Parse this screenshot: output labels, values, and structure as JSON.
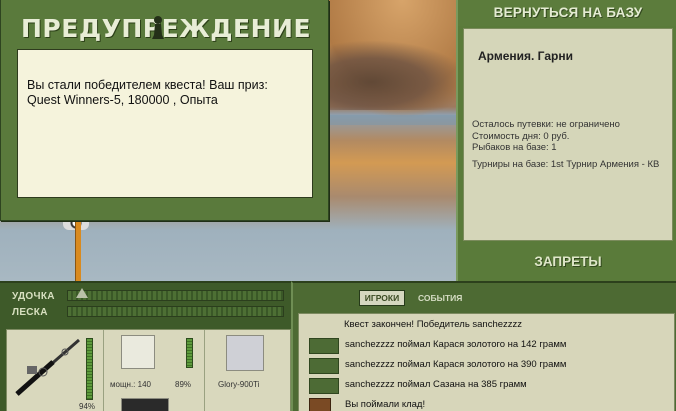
{
  "warning": {
    "title": "ПРЕДУПРЕЖДЕНИЕ",
    "message_line1": "Вы стали победителем квеста! Ваш приз:",
    "message_line2": "Quest Winners-5, 180000 , Опыта"
  },
  "base": {
    "return_label": "ВЕРНУТЬСЯ НА БАЗУ",
    "name": "Армения. Гарни",
    "info": {
      "permits": "Осталось путевки: не ограничено",
      "cost": "Стоимость дня: 0 руб.",
      "anglers": "Рыбаков на базе: 1",
      "tournaments": "Турниры на базе: 1st Турнир Армения - КВ"
    },
    "bans_label": "ЗАПРЕТЫ"
  },
  "meters": {
    "rod_label": "УДОЧКА",
    "line_label": "ЛЕСКА"
  },
  "tackle": {
    "rod_percent": "94%",
    "reel_power": "мощн.: 140",
    "reel_percent": "89%",
    "line_name": "Glory-900Ti"
  },
  "chat": {
    "tab_players": "ИГРОКИ",
    "tab_events": "СОБЫТИЯ",
    "events": [
      "Квест закончен! Победитель sanchezzzz",
      "sanchezzzz поймал Карася золотого на 142 грамм",
      "sanchezzzz поймал Карася золотого на 390 грамм",
      "sanchezzzz поймал Сазана на 385 грамм",
      "Вы поймали клад!"
    ]
  }
}
